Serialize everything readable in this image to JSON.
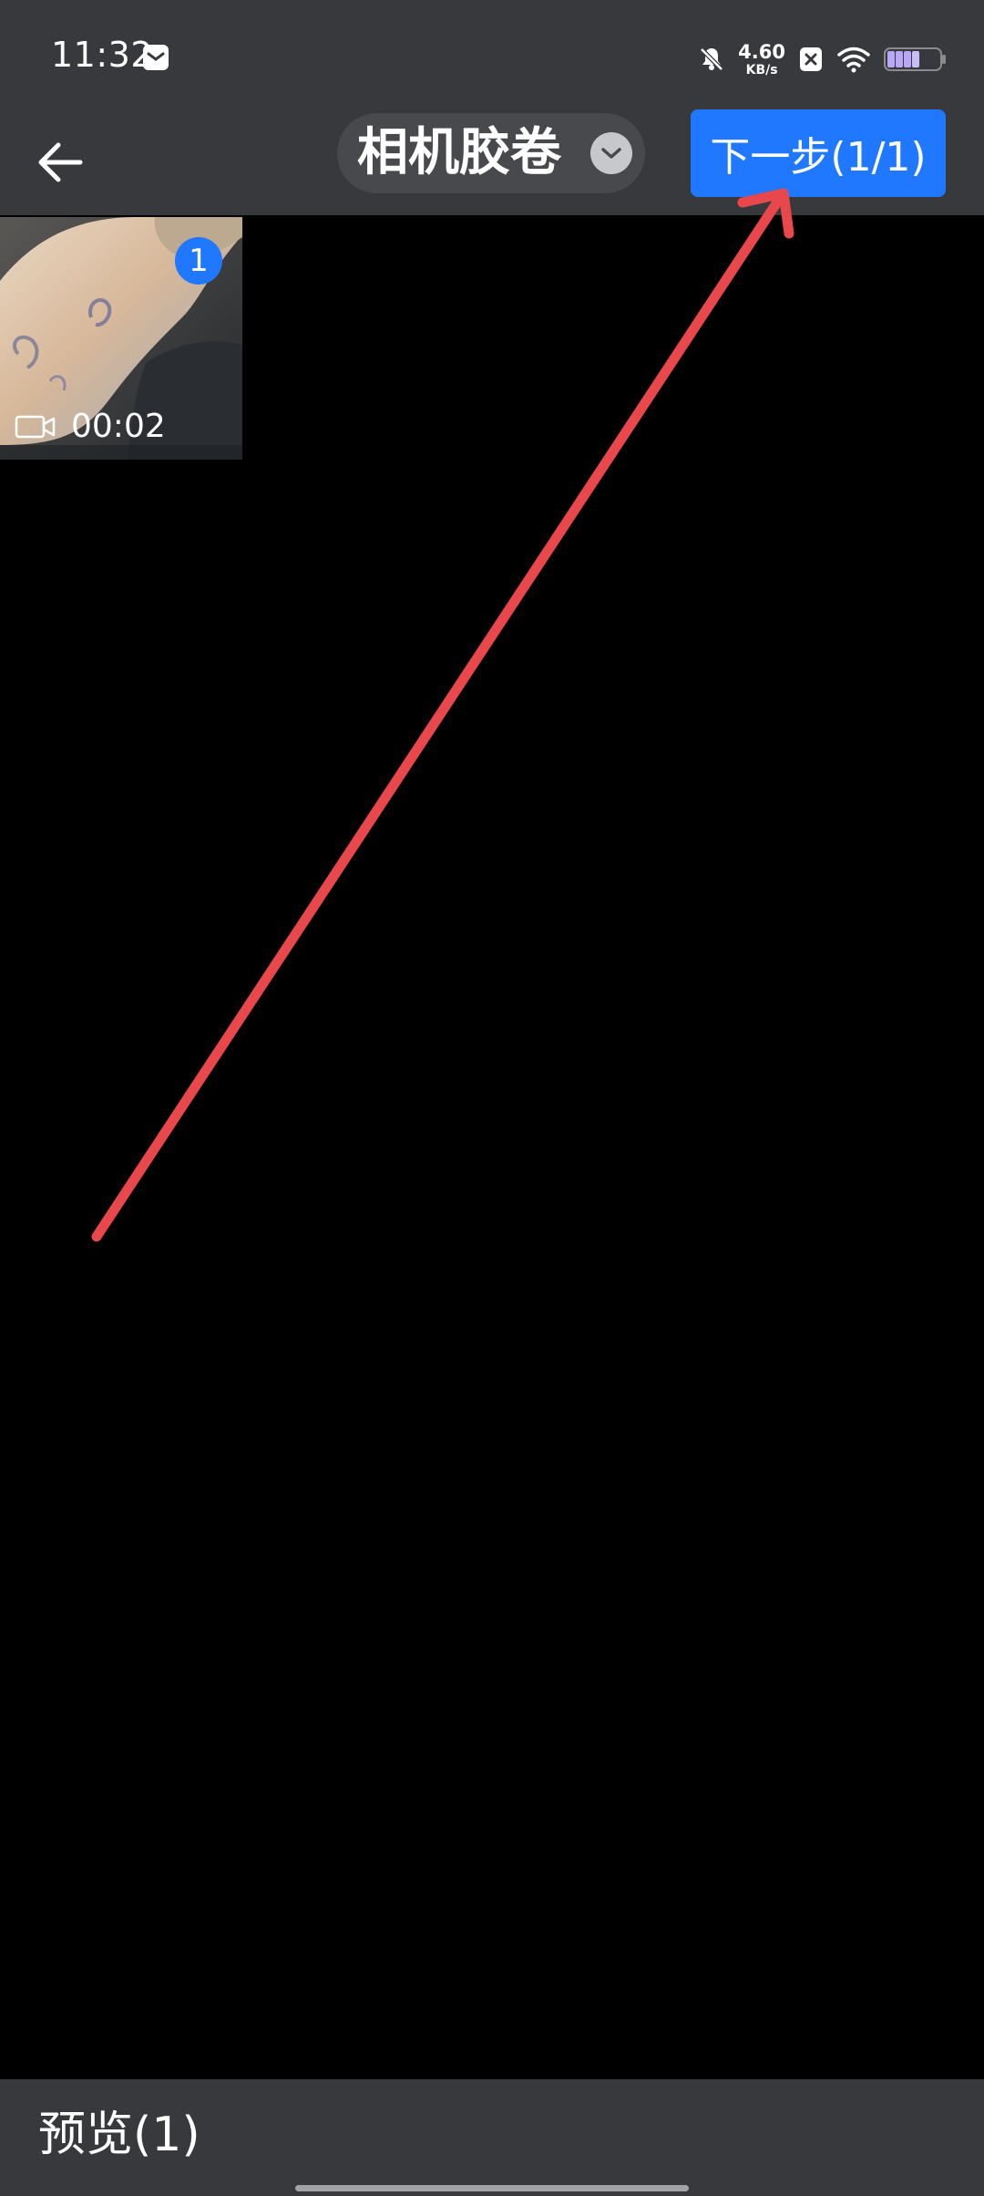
{
  "status_bar": {
    "time": "11:32",
    "network_speed_value": "4.60",
    "network_speed_unit": "KB/s",
    "icons": [
      "mail-notification-icon",
      "bell-muted-icon",
      "x-badge-icon",
      "wifi-icon",
      "battery-icon"
    ],
    "battery_level": 0.45
  },
  "header": {
    "album_title": "相机胶卷",
    "next_button_label": "下一步(1/1)",
    "accent_color": "#1f78ff"
  },
  "grid": {
    "items": [
      {
        "selection_index": "1",
        "duration": "00:02",
        "type_icon": "video-camera-icon"
      }
    ]
  },
  "bottom_bar": {
    "preview_label": "预览(1)"
  },
  "annotation": {
    "type": "arrow",
    "color": "#e8474c",
    "points_to": "next-button"
  }
}
